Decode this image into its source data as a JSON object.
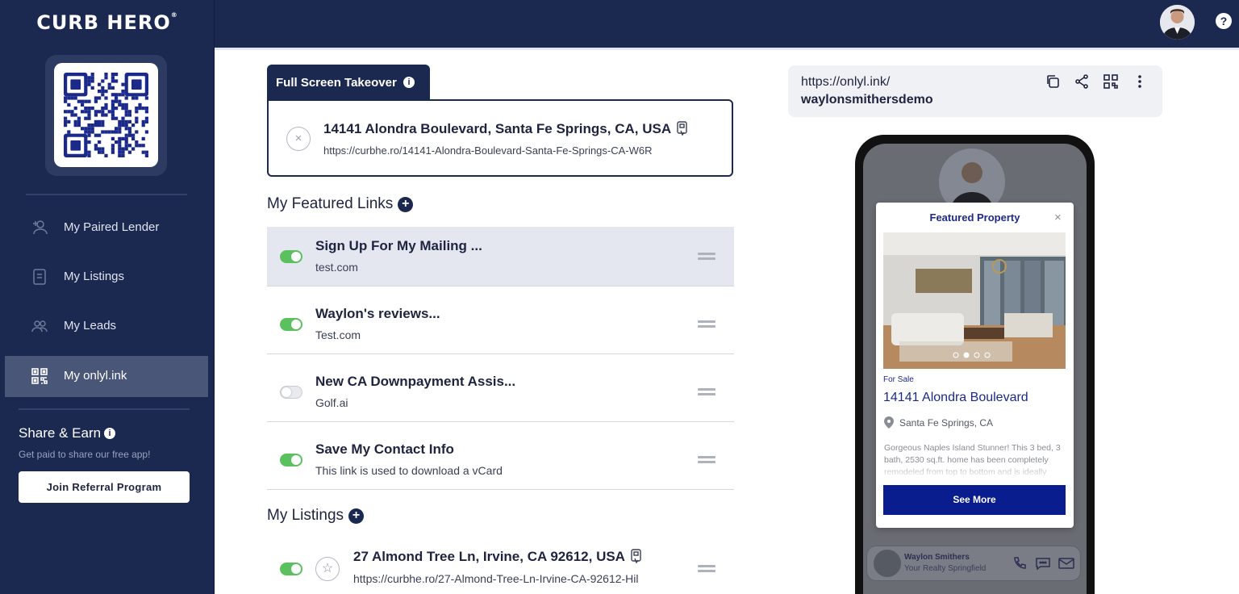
{
  "app": {
    "logo_text": "CURB HERO",
    "logo_mark": "®"
  },
  "sidebar": {
    "items": [
      {
        "label": "My Paired Lender",
        "icon": "add-person-icon"
      },
      {
        "label": "My Listings",
        "icon": "document-icon"
      },
      {
        "label": "My Leads",
        "icon": "people-icon"
      },
      {
        "label": "My onlyl.ink",
        "icon": "qr-code-icon",
        "active": true
      }
    ],
    "share_title": "Share & Earn",
    "share_info_glyph": "i",
    "share_subtitle": "Get paid to share our free app!",
    "referral_button": "Join Referral Program"
  },
  "topbar": {
    "help_glyph": "?"
  },
  "takeover": {
    "tab_label": "Full Screen Takeover",
    "info_glyph": "i",
    "remove_glyph": "×",
    "title": "14141 Alondra Boulevard, Santa Fe Springs, CA, USA",
    "url": "https://curbhe.ro/14141-Alondra-Boulevard-Santa-Fe-Springs-CA-W6R"
  },
  "featured_links": {
    "title": "My Featured Links",
    "add_glyph": "+",
    "items": [
      {
        "title": "Sign Up For My Mailing ...",
        "subtitle": "test.com",
        "enabled": true
      },
      {
        "title": "Waylon's reviews...",
        "subtitle": "Test.com",
        "enabled": true
      },
      {
        "title": "New CA Downpayment Assis...",
        "subtitle": "Golf.ai",
        "enabled": false
      },
      {
        "title": "Save My Contact Info",
        "subtitle": "This link is used to download a vCard",
        "enabled": true
      }
    ]
  },
  "listings": {
    "title": "My Listings",
    "add_glyph": "+",
    "items": [
      {
        "title": "27 Almond Tree Ln, Irvine, CA 92612, USA",
        "url": "https://curbhe.ro/27-Almond-Tree-Ln-Irvine-CA-92612-Hil",
        "enabled": true,
        "star_glyph": "☆"
      }
    ]
  },
  "share_link": {
    "line1": "https://onlyl.ink/",
    "line2": "waylonsmithersdemo"
  },
  "phone_preview": {
    "modal_title": "Featured Property",
    "close_glyph": "×",
    "status": "For Sale",
    "address": "14141 Alondra Boulevard",
    "city": "Santa Fe Springs, CA",
    "description": "Gorgeous Naples Island Stunner! This 3 bed, 3 bath, 2530 sq.ft. home has been completely remodeled from top to bottom and is ideally",
    "button": "See More",
    "agent_name": "Waylon Smithers",
    "agent_company": "Your Realty Springfield",
    "carousel_dots": 4,
    "carousel_active": 1
  },
  "colors": {
    "navy": "#1b2850",
    "toggle_on": "#5ac15e",
    "accent_blue": "#0a1d8f"
  }
}
